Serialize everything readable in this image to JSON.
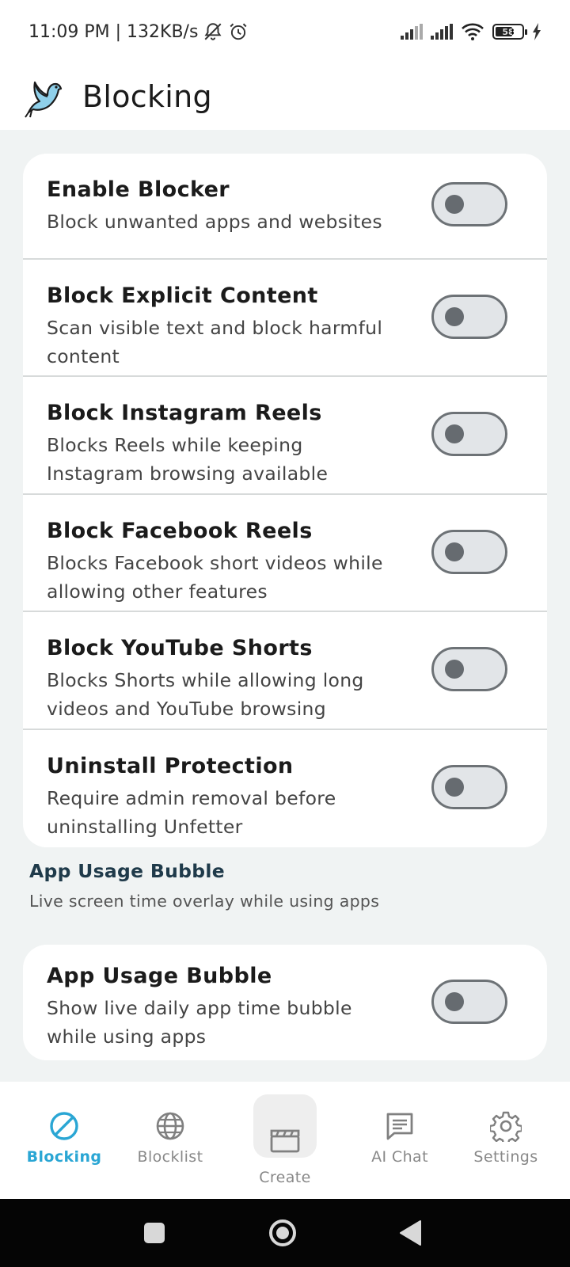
{
  "status": {
    "time_speed": "11:09 PM | 132KB/s",
    "battery": "58"
  },
  "header": {
    "title": "Blocking",
    "logo_icon": "dove-icon"
  },
  "toggles": [
    {
      "title": "Enable Blocker",
      "subtitle": "Block unwanted apps and websites",
      "on": false
    },
    {
      "title": "Block Explicit Content",
      "subtitle": "Scan visible text and block harmful content",
      "on": false
    },
    {
      "title": "Block Instagram Reels",
      "subtitle": "Blocks Reels while keeping Instagram browsing available",
      "on": false
    },
    {
      "title": "Block Facebook Reels",
      "subtitle": "Blocks Facebook short videos while allowing other features",
      "on": false
    },
    {
      "title": "Block YouTube Shorts",
      "subtitle": "Blocks Shorts while allowing long videos and YouTube browsing",
      "on": false
    },
    {
      "title": "Uninstall Protection",
      "subtitle": "Require admin removal before uninstalling Unfetter",
      "on": false
    }
  ],
  "bubble_section": {
    "title": "App Usage Bubble",
    "subtitle": "Live screen time overlay while using apps",
    "toggle": {
      "title": "App Usage Bubble",
      "subtitle": "Show live daily app time bubble while using apps",
      "on": false
    }
  },
  "nav": [
    {
      "label": "Blocking",
      "icon": "block-icon",
      "active": true
    },
    {
      "label": "Blocklist",
      "icon": "globe-icon",
      "active": false
    },
    {
      "label": "Create",
      "icon": "clapperboard-icon",
      "active": false
    },
    {
      "label": "AI Chat",
      "icon": "chat-icon",
      "active": false
    },
    {
      "label": "Settings",
      "icon": "gear-icon",
      "active": false
    }
  ],
  "colors": {
    "accent": "#2aa6d4",
    "background": "#f0f3f3",
    "toggle_off_track": "#e2e5e8",
    "toggle_off_border": "#6d7276"
  }
}
